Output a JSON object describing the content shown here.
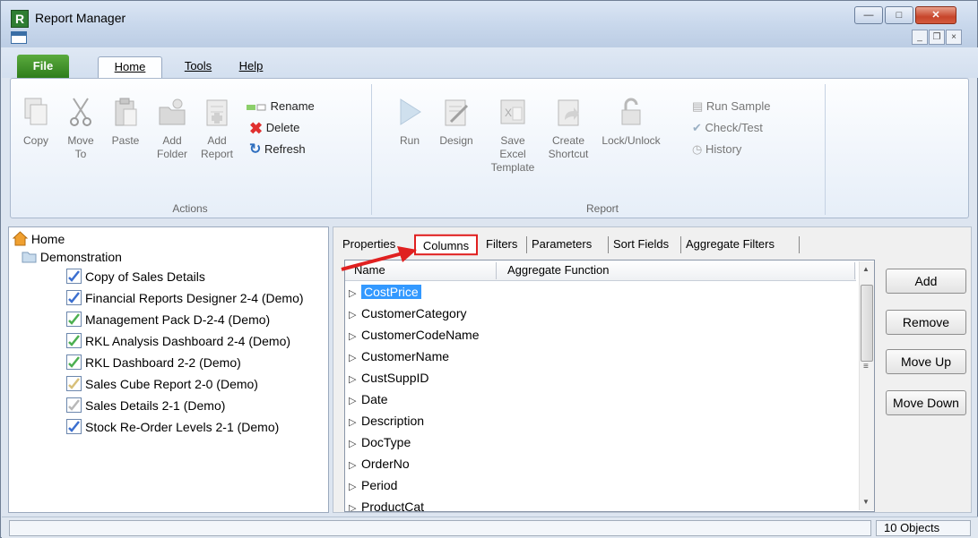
{
  "window": {
    "title": "Report Manager",
    "app_icon_letter": "R"
  },
  "ribbon_tabs": {
    "file": "File",
    "home": "Home",
    "tools": "Tools",
    "help": "Help"
  },
  "actions": {
    "copy": "Copy",
    "move_1": "Move",
    "move_2": "To",
    "paste": "Paste",
    "add_folder_1": "Add",
    "add_folder_2": "Folder",
    "add_report_1": "Add",
    "add_report_2": "Report",
    "rename": "Rename",
    "delete": "Delete",
    "refresh": "Refresh",
    "group_label": "Actions"
  },
  "report": {
    "run": "Run",
    "design": "Design",
    "save_excel_1": "Save Excel",
    "save_excel_2": "Template",
    "create_shortcut_1": "Create",
    "create_shortcut_2": "Shortcut",
    "lock_unlock": "Lock/Unlock",
    "run_sample": "Run Sample",
    "check_test": "Check/Test",
    "history": "History",
    "group_label": "Report"
  },
  "tree": {
    "home": "Home",
    "folder": "Demonstration",
    "items": [
      "Copy of Sales Details",
      "Financial Reports Designer 2-4 (Demo)",
      "Management Pack D-2-4 (Demo)",
      "RKL Analysis Dashboard 2-4 (Demo)",
      "RKL Dashboard 2-2 (Demo)",
      "Sales Cube Report 2-0 (Demo)",
      "Sales Details 2-1 (Demo)",
      "Stock Re-Order Levels 2-1 (Demo)"
    ]
  },
  "detail_tabs": {
    "properties": "Properties",
    "columns": "Columns",
    "filters": "Filters",
    "parameters": "Parameters",
    "sort_fields": "Sort Fields",
    "aggregate_filters": "Aggregate Filters"
  },
  "grid": {
    "col_name": "Name",
    "col_aggregate": "Aggregate Function",
    "rows": [
      "CostPrice",
      "CustomerCategory",
      "CustomerCodeName",
      "CustomerName",
      "CustSuppID",
      "Date",
      "Description",
      "DocType",
      "OrderNo",
      "Period",
      "ProductCat"
    ]
  },
  "buttons": {
    "add": "Add",
    "remove": "Remove",
    "move_up": "Move Up",
    "move_down": "Move Down"
  },
  "status": {
    "count": "10 Objects"
  },
  "colors": {
    "highlight": "#e02020",
    "selection": "#3399ff",
    "file_tab": "#3f8f2a"
  }
}
